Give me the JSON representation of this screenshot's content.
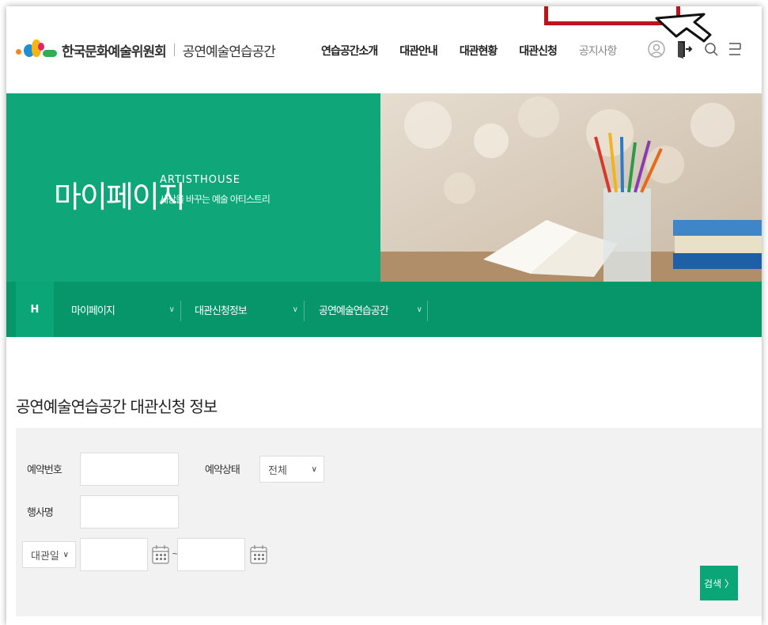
{
  "header": {
    "org_name": "한국문화예술위원회",
    "site_name": "공연예술연습공간",
    "nav": [
      "연습공간소개",
      "대관안내",
      "대관현황",
      "대관신청",
      "공지사항"
    ]
  },
  "banner": {
    "title": "마이페이지",
    "title_en": "ARTISTHOUSE",
    "subtitle": "세상을 바꾸는 예술 아티스트리"
  },
  "subnav": {
    "home": "H",
    "items": [
      "마이페이지",
      "대관신청정보",
      "공연예술연습공간"
    ]
  },
  "content": {
    "page_title": "공연예술연습공간 대관신청 정보",
    "form": {
      "reservation_no_label": "예약번호",
      "reservation_status_label": "예약상태",
      "reservation_status_value": "전체",
      "event_name_label": "행사명",
      "date_type_value": "대관일",
      "date_separator": "~",
      "search_button": "검색 〉"
    }
  },
  "colors": {
    "primary_green": "#0fa77a",
    "subnav_green": "#07956a",
    "highlight_red": "#c0121a"
  }
}
